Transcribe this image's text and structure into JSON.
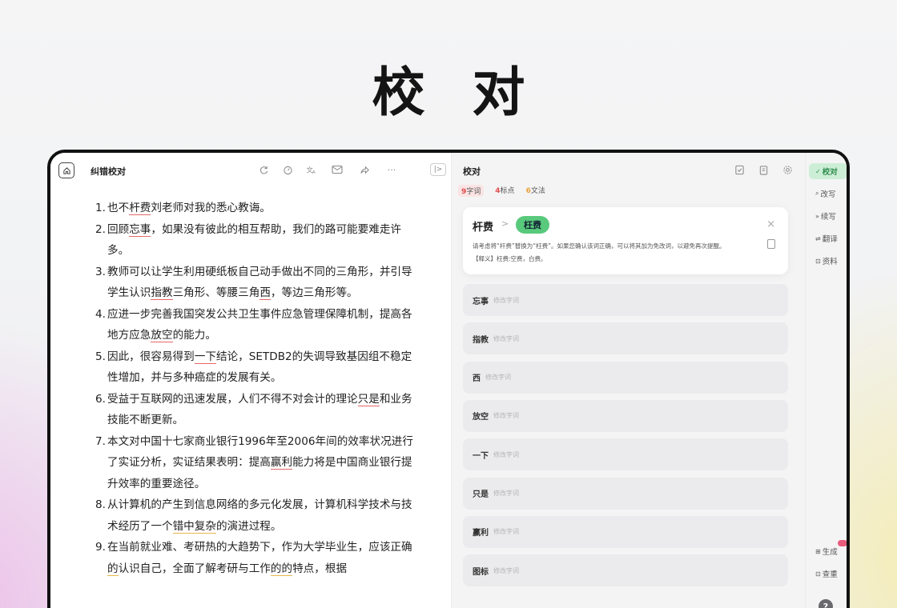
{
  "hero": {
    "title": "校 对"
  },
  "editor": {
    "title": "纠错校对",
    "toolbar": [
      "refresh-icon",
      "timer-icon",
      "translate-icon",
      "mail-icon",
      "share-icon",
      "more-icon"
    ],
    "collapse_label": "|>",
    "items": [
      {
        "num": "1.",
        "segments": [
          {
            "t": "也不"
          },
          {
            "t": "杆费",
            "hl": "red"
          },
          {
            "t": "刘老师对我的悉心教诲。"
          }
        ]
      },
      {
        "num": "2.",
        "segments": [
          {
            "t": "回顾"
          },
          {
            "t": "忘事",
            "hl": "red"
          },
          {
            "t": "，如果没有彼此的相互帮助，我们的路可能要难走许多。"
          }
        ]
      },
      {
        "num": "3.",
        "segments": [
          {
            "t": "教师可以让学生利用硬纸板自己动手做出不同的三角形，并引导学生认识"
          },
          {
            "t": "指教",
            "hl": "red"
          },
          {
            "t": "三角形、等腰三角"
          },
          {
            "t": "西",
            "hl": "red"
          },
          {
            "t": "，等边三角形等。"
          }
        ]
      },
      {
        "num": "4.",
        "segments": [
          {
            "t": "应进一步完善我国突发公共卫生事件应急管理保障机制，提高各地方应急"
          },
          {
            "t": "放空",
            "hl": "red"
          },
          {
            "t": "的能力。"
          }
        ]
      },
      {
        "num": "5.",
        "segments": [
          {
            "t": "因此，很容易得到"
          },
          {
            "t": "一下",
            "hl": "red"
          },
          {
            "t": "结论，SETDB2的失调导致基因组不稳定性增加，并与多种癌症的发展有关。"
          }
        ]
      },
      {
        "num": "6.",
        "segments": [
          {
            "t": "受益于互联网的迅速发展，人们不得不对会计的理论"
          },
          {
            "t": "只是",
            "hl": "red"
          },
          {
            "t": "和业务技能不断更新。"
          }
        ]
      },
      {
        "num": "7.",
        "segments": [
          {
            "t": "本文对中国十七家商业银行1996年至2006年间的效率状况进行了实证分析，实证结果表明：提高"
          },
          {
            "t": "赢利",
            "hl": "red"
          },
          {
            "t": "能力将是中国商业银行提升效率的重要途径。"
          }
        ]
      },
      {
        "num": "8.",
        "segments": [
          {
            "t": "从计算机的产生到信息网络的多元化发展，计算机科学技术与技术经历了一个"
          },
          {
            "t": "错中复杂",
            "hl": "yellow"
          },
          {
            "t": "的演进过程。"
          }
        ]
      },
      {
        "num": "9.",
        "segments": [
          {
            "t": "在当前就业难、考研热的大趋势下，作为大学毕业生，应该正确"
          },
          {
            "t": "的",
            "hl": "yellow"
          },
          {
            "t": "认识自己，全面了解考研与工作"
          },
          {
            "t": "的的",
            "hl": "yellow"
          },
          {
            "t": "特点，根据"
          }
        ]
      }
    ]
  },
  "proofread": {
    "title": "校对",
    "header_icons": [
      "note-check-icon",
      "clipboard-icon",
      "settings-icon"
    ],
    "tabs": [
      {
        "count": "9",
        "label": "字词",
        "color": "red",
        "active": true
      },
      {
        "count": "4",
        "label": "标点",
        "color": "red",
        "active": false
      },
      {
        "count": "6",
        "label": "文法",
        "color": "orange",
        "active": false
      }
    ],
    "active_card": {
      "original": "杆费",
      "arrow": ">",
      "suggestion": "枉费",
      "close": "×",
      "description": "请考虑将“杆费”替换为“枉费”。如果您确认该词正确，可以将其加为免改词，以避免再次提醒。",
      "definition": "【释义】枉费:空费，白费。"
    },
    "cards": [
      {
        "word": "忘事",
        "hint": "修改字词"
      },
      {
        "word": "指教",
        "hint": "修改字词"
      },
      {
        "word": "西",
        "hint": "修改字词"
      },
      {
        "word": "放空",
        "hint": "修改字词"
      },
      {
        "word": "一下",
        "hint": "修改字词"
      },
      {
        "word": "只是",
        "hint": "修改字词"
      },
      {
        "word": "赢利",
        "hint": "修改字词"
      },
      {
        "word": "图标",
        "hint": "修改字词"
      }
    ]
  },
  "sidebar": {
    "items": [
      {
        "icon": "✓",
        "label": "校对",
        "active": true
      },
      {
        "icon": "⌕",
        "label": "改写"
      },
      {
        "icon": "»",
        "label": "续写"
      },
      {
        "icon": "⇌",
        "label": "翻译"
      },
      {
        "icon": "⊡",
        "label": "资料"
      }
    ],
    "bottom": [
      {
        "icon": "⊞",
        "label": "生成",
        "badge": true
      },
      {
        "icon": "⊡",
        "label": "查重"
      }
    ],
    "help": "?"
  },
  "colors": {
    "accent": "#59c97c",
    "error": "#e46868",
    "warning": "#e7b64a"
  }
}
